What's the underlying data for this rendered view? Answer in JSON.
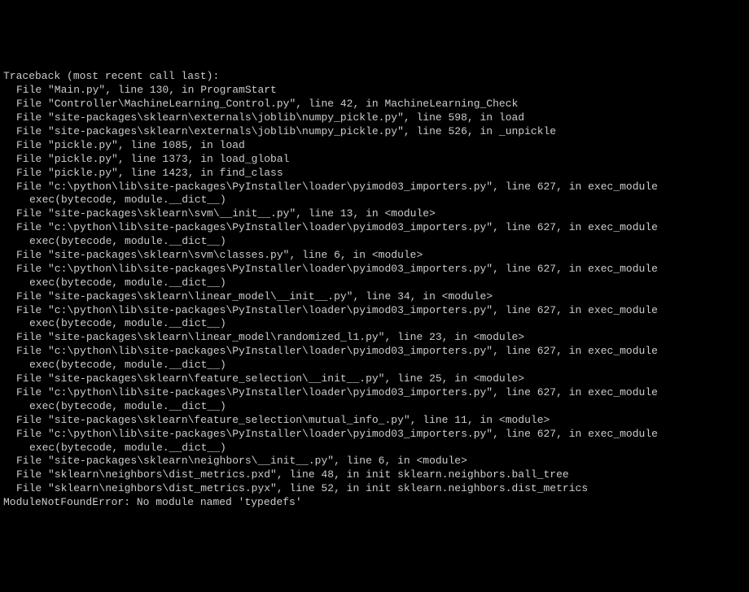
{
  "traceback": {
    "header": "Traceback (most recent call last):",
    "lines": [
      {
        "indent": 1,
        "text": "File \"Main.py\", line 130, in ProgramStart"
      },
      {
        "indent": 1,
        "text": "File \"Controller\\MachineLearning_Control.py\", line 42, in MachineLearning_Check"
      },
      {
        "indent": 1,
        "text": "File \"site-packages\\sklearn\\externals\\joblib\\numpy_pickle.py\", line 598, in load"
      },
      {
        "indent": 1,
        "text": "File \"site-packages\\sklearn\\externals\\joblib\\numpy_pickle.py\", line 526, in _unpickle"
      },
      {
        "indent": 1,
        "text": "File \"pickle.py\", line 1085, in load"
      },
      {
        "indent": 1,
        "text": "File \"pickle.py\", line 1373, in load_global"
      },
      {
        "indent": 1,
        "text": "File \"pickle.py\", line 1423, in find_class"
      },
      {
        "indent": 1,
        "text": "File \"c:\\python\\lib\\site-packages\\PyInstaller\\loader\\pyimod03_importers.py\", line 627, in exec_module"
      },
      {
        "indent": 2,
        "text": "exec(bytecode, module.__dict__)"
      },
      {
        "indent": 1,
        "text": "File \"site-packages\\sklearn\\svm\\__init__.py\", line 13, in <module>"
      },
      {
        "indent": 1,
        "text": "File \"c:\\python\\lib\\site-packages\\PyInstaller\\loader\\pyimod03_importers.py\", line 627, in exec_module"
      },
      {
        "indent": 2,
        "text": "exec(bytecode, module.__dict__)"
      },
      {
        "indent": 1,
        "text": "File \"site-packages\\sklearn\\svm\\classes.py\", line 6, in <module>"
      },
      {
        "indent": 1,
        "text": "File \"c:\\python\\lib\\site-packages\\PyInstaller\\loader\\pyimod03_importers.py\", line 627, in exec_module"
      },
      {
        "indent": 2,
        "text": "exec(bytecode, module.__dict__)"
      },
      {
        "indent": 1,
        "text": "File \"site-packages\\sklearn\\linear_model\\__init__.py\", line 34, in <module>"
      },
      {
        "indent": 1,
        "text": "File \"c:\\python\\lib\\site-packages\\PyInstaller\\loader\\pyimod03_importers.py\", line 627, in exec_module"
      },
      {
        "indent": 2,
        "text": "exec(bytecode, module.__dict__)"
      },
      {
        "indent": 1,
        "text": "File \"site-packages\\sklearn\\linear_model\\randomized_l1.py\", line 23, in <module>"
      },
      {
        "indent": 1,
        "text": "File \"c:\\python\\lib\\site-packages\\PyInstaller\\loader\\pyimod03_importers.py\", line 627, in exec_module"
      },
      {
        "indent": 2,
        "text": "exec(bytecode, module.__dict__)"
      },
      {
        "indent": 1,
        "text": "File \"site-packages\\sklearn\\feature_selection\\__init__.py\", line 25, in <module>"
      },
      {
        "indent": 1,
        "text": "File \"c:\\python\\lib\\site-packages\\PyInstaller\\loader\\pyimod03_importers.py\", line 627, in exec_module"
      },
      {
        "indent": 2,
        "text": "exec(bytecode, module.__dict__)"
      },
      {
        "indent": 1,
        "text": "File \"site-packages\\sklearn\\feature_selection\\mutual_info_.py\", line 11, in <module>"
      },
      {
        "indent": 1,
        "text": "File \"c:\\python\\lib\\site-packages\\PyInstaller\\loader\\pyimod03_importers.py\", line 627, in exec_module"
      },
      {
        "indent": 2,
        "text": "exec(bytecode, module.__dict__)"
      },
      {
        "indent": 1,
        "text": "File \"site-packages\\sklearn\\neighbors\\__init__.py\", line 6, in <module>"
      },
      {
        "indent": 1,
        "text": "File \"sklearn\\neighbors\\dist_metrics.pxd\", line 48, in init sklearn.neighbors.ball_tree"
      },
      {
        "indent": 1,
        "text": "File \"sklearn\\neighbors\\dist_metrics.pyx\", line 52, in init sklearn.neighbors.dist_metrics"
      }
    ],
    "error": "ModuleNotFoundError: No module named 'typedefs'"
  }
}
